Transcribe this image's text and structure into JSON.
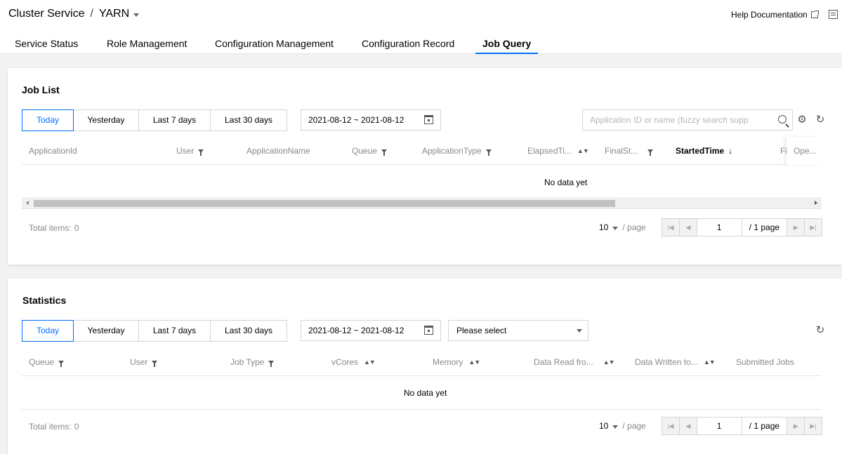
{
  "breadcrumb": {
    "service": "Cluster Service",
    "separator": "/",
    "component": "YARN"
  },
  "help": {
    "label": "Help Documentation"
  },
  "tabs": [
    {
      "label": "Service Status"
    },
    {
      "label": "Role Management"
    },
    {
      "label": "Configuration Management"
    },
    {
      "label": "Configuration Record"
    },
    {
      "label": "Job Query",
      "active": true
    }
  ],
  "job_list": {
    "title": "Job List",
    "ranges": [
      "Today",
      "Yesterday",
      "Last 7 days",
      "Last 30 days"
    ],
    "selected_range": "Today",
    "date_range": "2021-08-12 ~ 2021-08-12",
    "search_placeholder": "Application ID or name (fuzzy search supp",
    "columns": [
      "ApplicationId",
      "User",
      "ApplicationName",
      "Queue",
      "ApplicationType",
      "ElapsedTi...",
      "FinalSt...",
      "StartedTime",
      "Fi",
      "Ope..."
    ],
    "empty_text": "No data yet",
    "total_label": "Total items:",
    "total_value": "0",
    "page_size": "10",
    "per_page": "/ page",
    "page": "1",
    "page_total": "/ 1 page",
    "scroll_position": 0
  },
  "statistics": {
    "title": "Statistics",
    "ranges": [
      "Today",
      "Yesterday",
      "Last 7 days",
      "Last 30 days"
    ],
    "selected_range": "Today",
    "date_range": "2021-08-12 ~ 2021-08-12",
    "select_placeholder": "Please select",
    "columns": [
      "Queue",
      "User",
      "Job Type",
      "vCores",
      "Memory",
      "Data Read fro...",
      "Data Written to...",
      "Submitted Jobs"
    ],
    "empty_text": "No data yet",
    "total_label": "Total items:",
    "total_value": "0",
    "page_size": "10",
    "per_page": "/ page",
    "page": "1",
    "page_total": "/ 1 page"
  },
  "colors": {
    "accent": "#006eff",
    "muted": "#888888",
    "border": "#cfd5de"
  }
}
